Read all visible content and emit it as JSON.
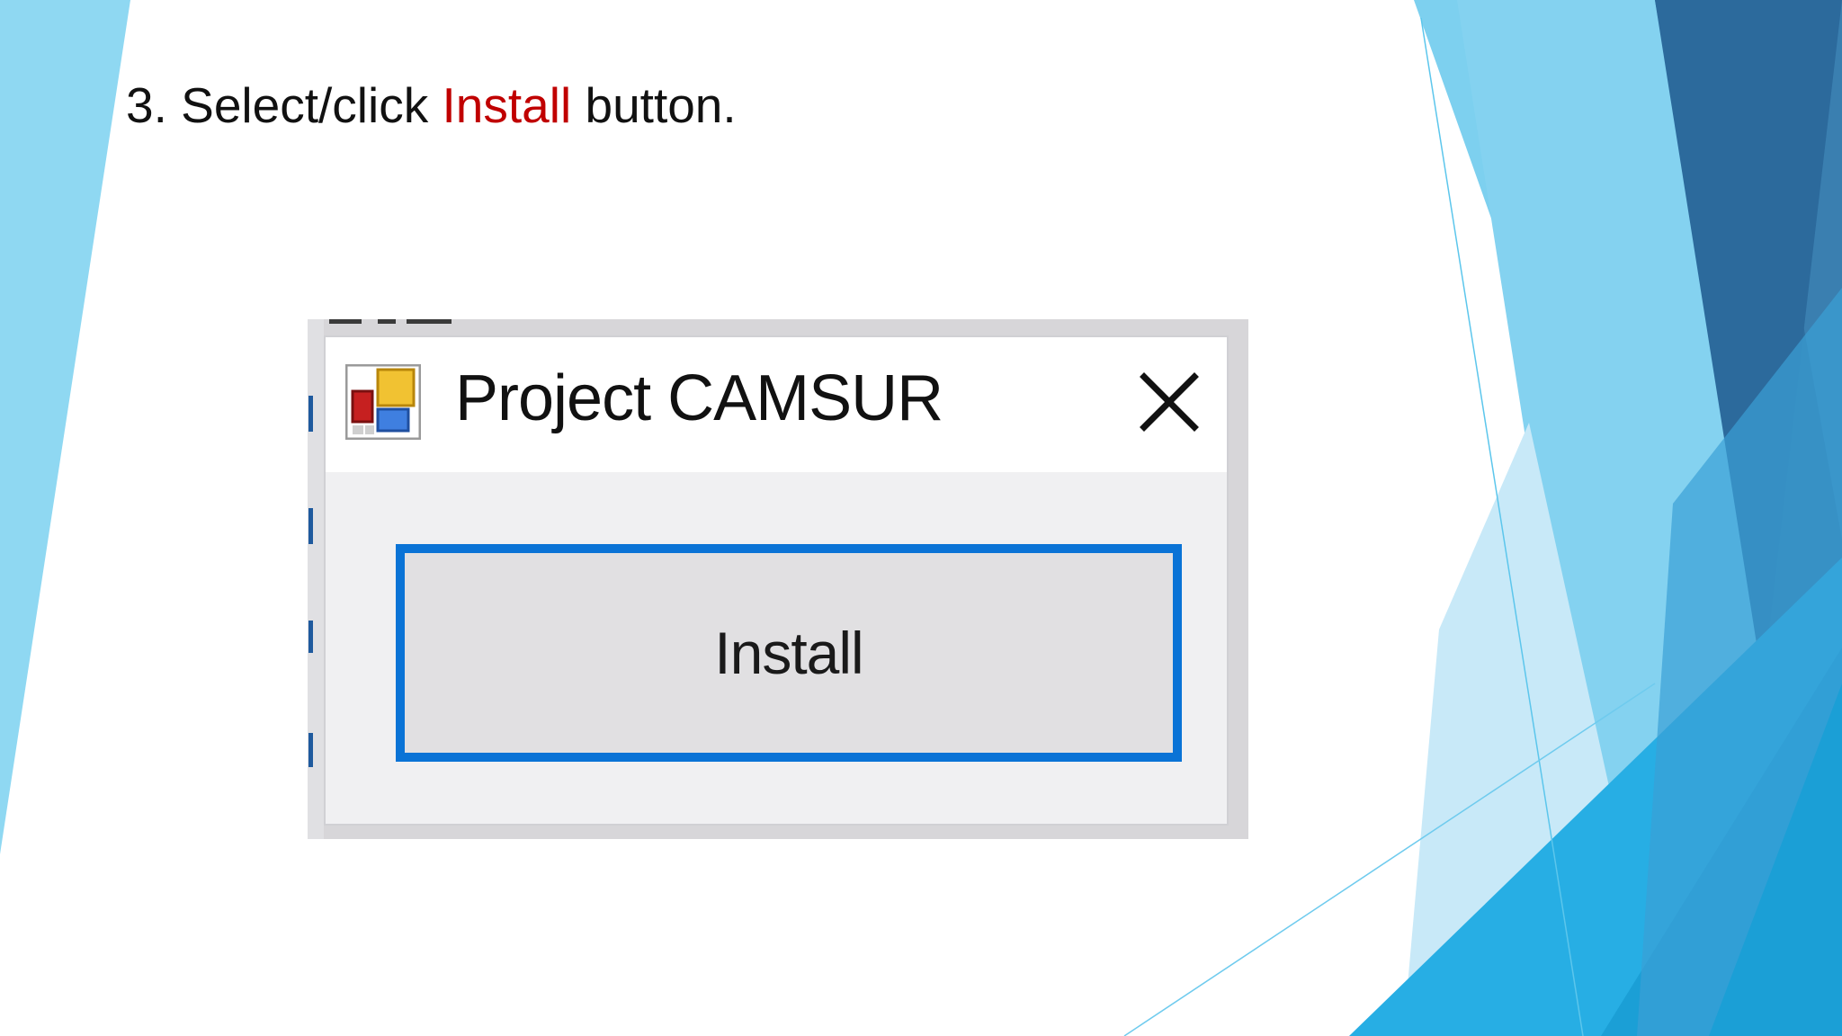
{
  "slide": {
    "instruction_prefix": "3. Select/click ",
    "instruction_highlight": "Install",
    "instruction_suffix": " button.",
    "highlight_color": "#c00000",
    "accent_colors": [
      "#8fd8f2",
      "#6fcbee",
      "#2f6e9f",
      "#1b9fd6"
    ]
  },
  "dialog": {
    "title": "Project CAMSUR",
    "app_icon": "app-icon",
    "close_icon": "close-icon",
    "install_label": "Install",
    "button_focus_color": "#0a73d6"
  }
}
